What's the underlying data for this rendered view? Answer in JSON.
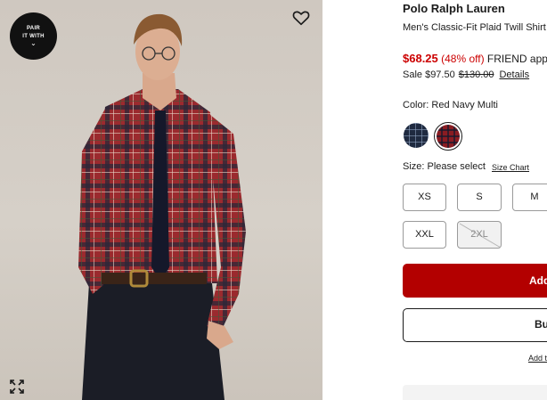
{
  "media": {
    "pair_label_line1": "PAIR",
    "pair_label_line2": "IT WITH",
    "pair_chevron": "⌄",
    "icons": [
      "heart-icon",
      "expand-icon",
      "chevron-down-icon"
    ]
  },
  "product": {
    "brand": "Polo Ralph Lauren",
    "name": "Men's Classic-Fit Plaid Twill Shirt",
    "sale_price": "$68.25",
    "discount": "(48% off)",
    "promo_text": "FRIEND applied",
    "sale_label": "Sale $97.50",
    "original_price": "$130.00",
    "details_link": "Details"
  },
  "color": {
    "label": "Color: Red Navy Multi",
    "swatches": [
      {
        "name": "Navy plaid",
        "color": "#1f2a40",
        "selected": false
      },
      {
        "name": "Red Navy Multi",
        "color": "#8a1c22",
        "selected": true
      }
    ]
  },
  "size": {
    "label": "Size: Please select",
    "chart_link": "Size Chart",
    "options": [
      {
        "label": "XS",
        "available": true
      },
      {
        "label": "S",
        "available": true
      },
      {
        "label": "M",
        "available": true
      },
      {
        "label": "XXL",
        "available": true
      },
      {
        "label": "2XL",
        "available": false
      }
    ]
  },
  "actions": {
    "add_to_bag": "Add",
    "buy_now": "Bu",
    "add_to_list": "Add t"
  },
  "colors": {
    "accent_red": "#cc0000",
    "button_red": "#b30000"
  }
}
